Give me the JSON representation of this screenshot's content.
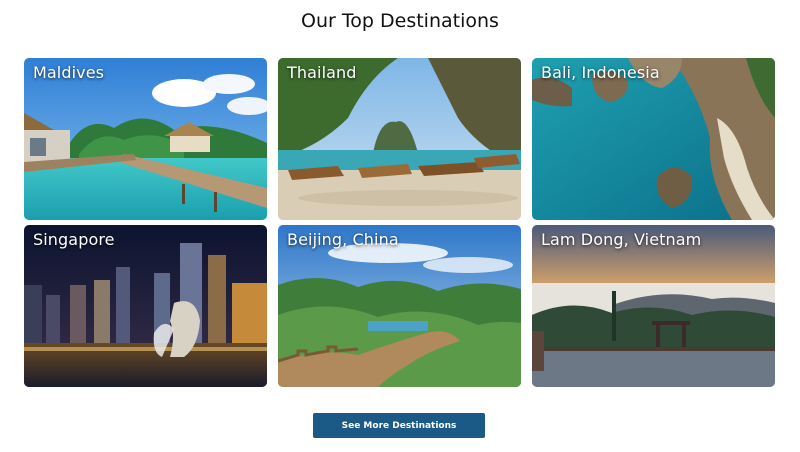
{
  "page": {
    "title": "Our Top Destinations"
  },
  "destinations": [
    {
      "name": "Maldives"
    },
    {
      "name": "Thailand"
    },
    {
      "name": "Bali, Indonesia"
    },
    {
      "name": "Singapore"
    },
    {
      "name": "Beijing, China"
    },
    {
      "name": "Lam Dong, Vietnam"
    }
  ],
  "cta": {
    "label": "See More Destinations",
    "color": "#1b5a86"
  }
}
